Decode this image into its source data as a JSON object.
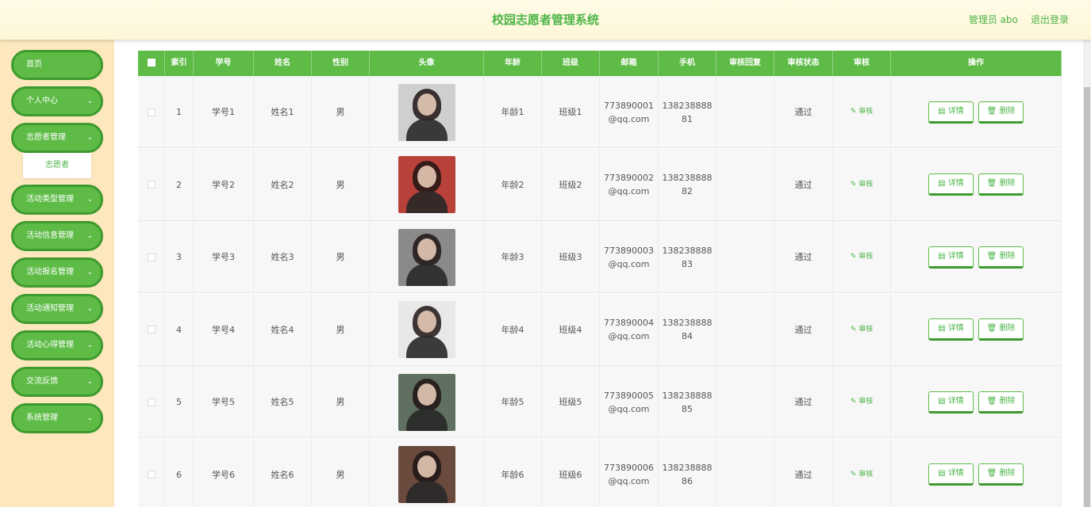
{
  "header": {
    "title": "校园志愿者管理系统",
    "user": "管理员 abo",
    "logout": "退出登录"
  },
  "sidebar": {
    "items": [
      {
        "label": "首页",
        "has_arrow": false
      },
      {
        "label": "个人中心",
        "has_arrow": true
      },
      {
        "label": "志愿者管理",
        "has_arrow": true
      },
      {
        "label": "活动类型管理",
        "has_arrow": true
      },
      {
        "label": "活动信息管理",
        "has_arrow": true
      },
      {
        "label": "活动报名管理",
        "has_arrow": true
      },
      {
        "label": "活动通知管理",
        "has_arrow": true
      },
      {
        "label": "活动心得管理",
        "has_arrow": true
      },
      {
        "label": "交流反馈",
        "has_arrow": true
      },
      {
        "label": "系统管理",
        "has_arrow": true
      }
    ],
    "submenu": "志愿者"
  },
  "table": {
    "headers": [
      "索引",
      "学号",
      "姓名",
      "性别",
      "头像",
      "年龄",
      "班级",
      "邮箱",
      "手机",
      "审核回复",
      "审核状态",
      "审核",
      "操作"
    ],
    "audit_label": "审核",
    "detail_label": "详情",
    "delete_label": "删除",
    "rows": [
      {
        "index": "1",
        "student_no": "学号1",
        "name": "姓名1",
        "gender": "男",
        "age": "年龄1",
        "class": "班级1",
        "email_1": "773890001",
        "email_2": "@qq.com",
        "phone_1": "138238888",
        "phone_2": "81",
        "reply": "",
        "status": "通过",
        "avatar_color": "#cfcfcf"
      },
      {
        "index": "2",
        "student_no": "学号2",
        "name": "姓名2",
        "gender": "男",
        "age": "年龄2",
        "class": "班级2",
        "email_1": "773890002",
        "email_2": "@qq.com",
        "phone_1": "138238888",
        "phone_2": "82",
        "reply": "",
        "status": "通过",
        "avatar_color": "#b8423a"
      },
      {
        "index": "3",
        "student_no": "学号3",
        "name": "姓名3",
        "gender": "男",
        "age": "年龄3",
        "class": "班级3",
        "email_1": "773890003",
        "email_2": "@qq.com",
        "phone_1": "138238888",
        "phone_2": "83",
        "reply": "",
        "status": "通过",
        "avatar_color": "#8a8a8a"
      },
      {
        "index": "4",
        "student_no": "学号4",
        "name": "姓名4",
        "gender": "男",
        "age": "年龄4",
        "class": "班级4",
        "email_1": "773890004",
        "email_2": "@qq.com",
        "phone_1": "138238888",
        "phone_2": "84",
        "reply": "",
        "status": "通过",
        "avatar_color": "#e8e8e8"
      },
      {
        "index": "5",
        "student_no": "学号5",
        "name": "姓名5",
        "gender": "男",
        "age": "年龄5",
        "class": "班级5",
        "email_1": "773890005",
        "email_2": "@qq.com",
        "phone_1": "138238888",
        "phone_2": "85",
        "reply": "",
        "status": "通过",
        "avatar_color": "#5f6f60"
      },
      {
        "index": "6",
        "student_no": "学号6",
        "name": "姓名6",
        "gender": "男",
        "age": "年龄6",
        "class": "班级6",
        "email_1": "773890006",
        "email_2": "@qq.com",
        "phone_1": "138238888",
        "phone_2": "86",
        "reply": "",
        "status": "通过",
        "avatar_color": "#6b4a3e"
      }
    ]
  }
}
